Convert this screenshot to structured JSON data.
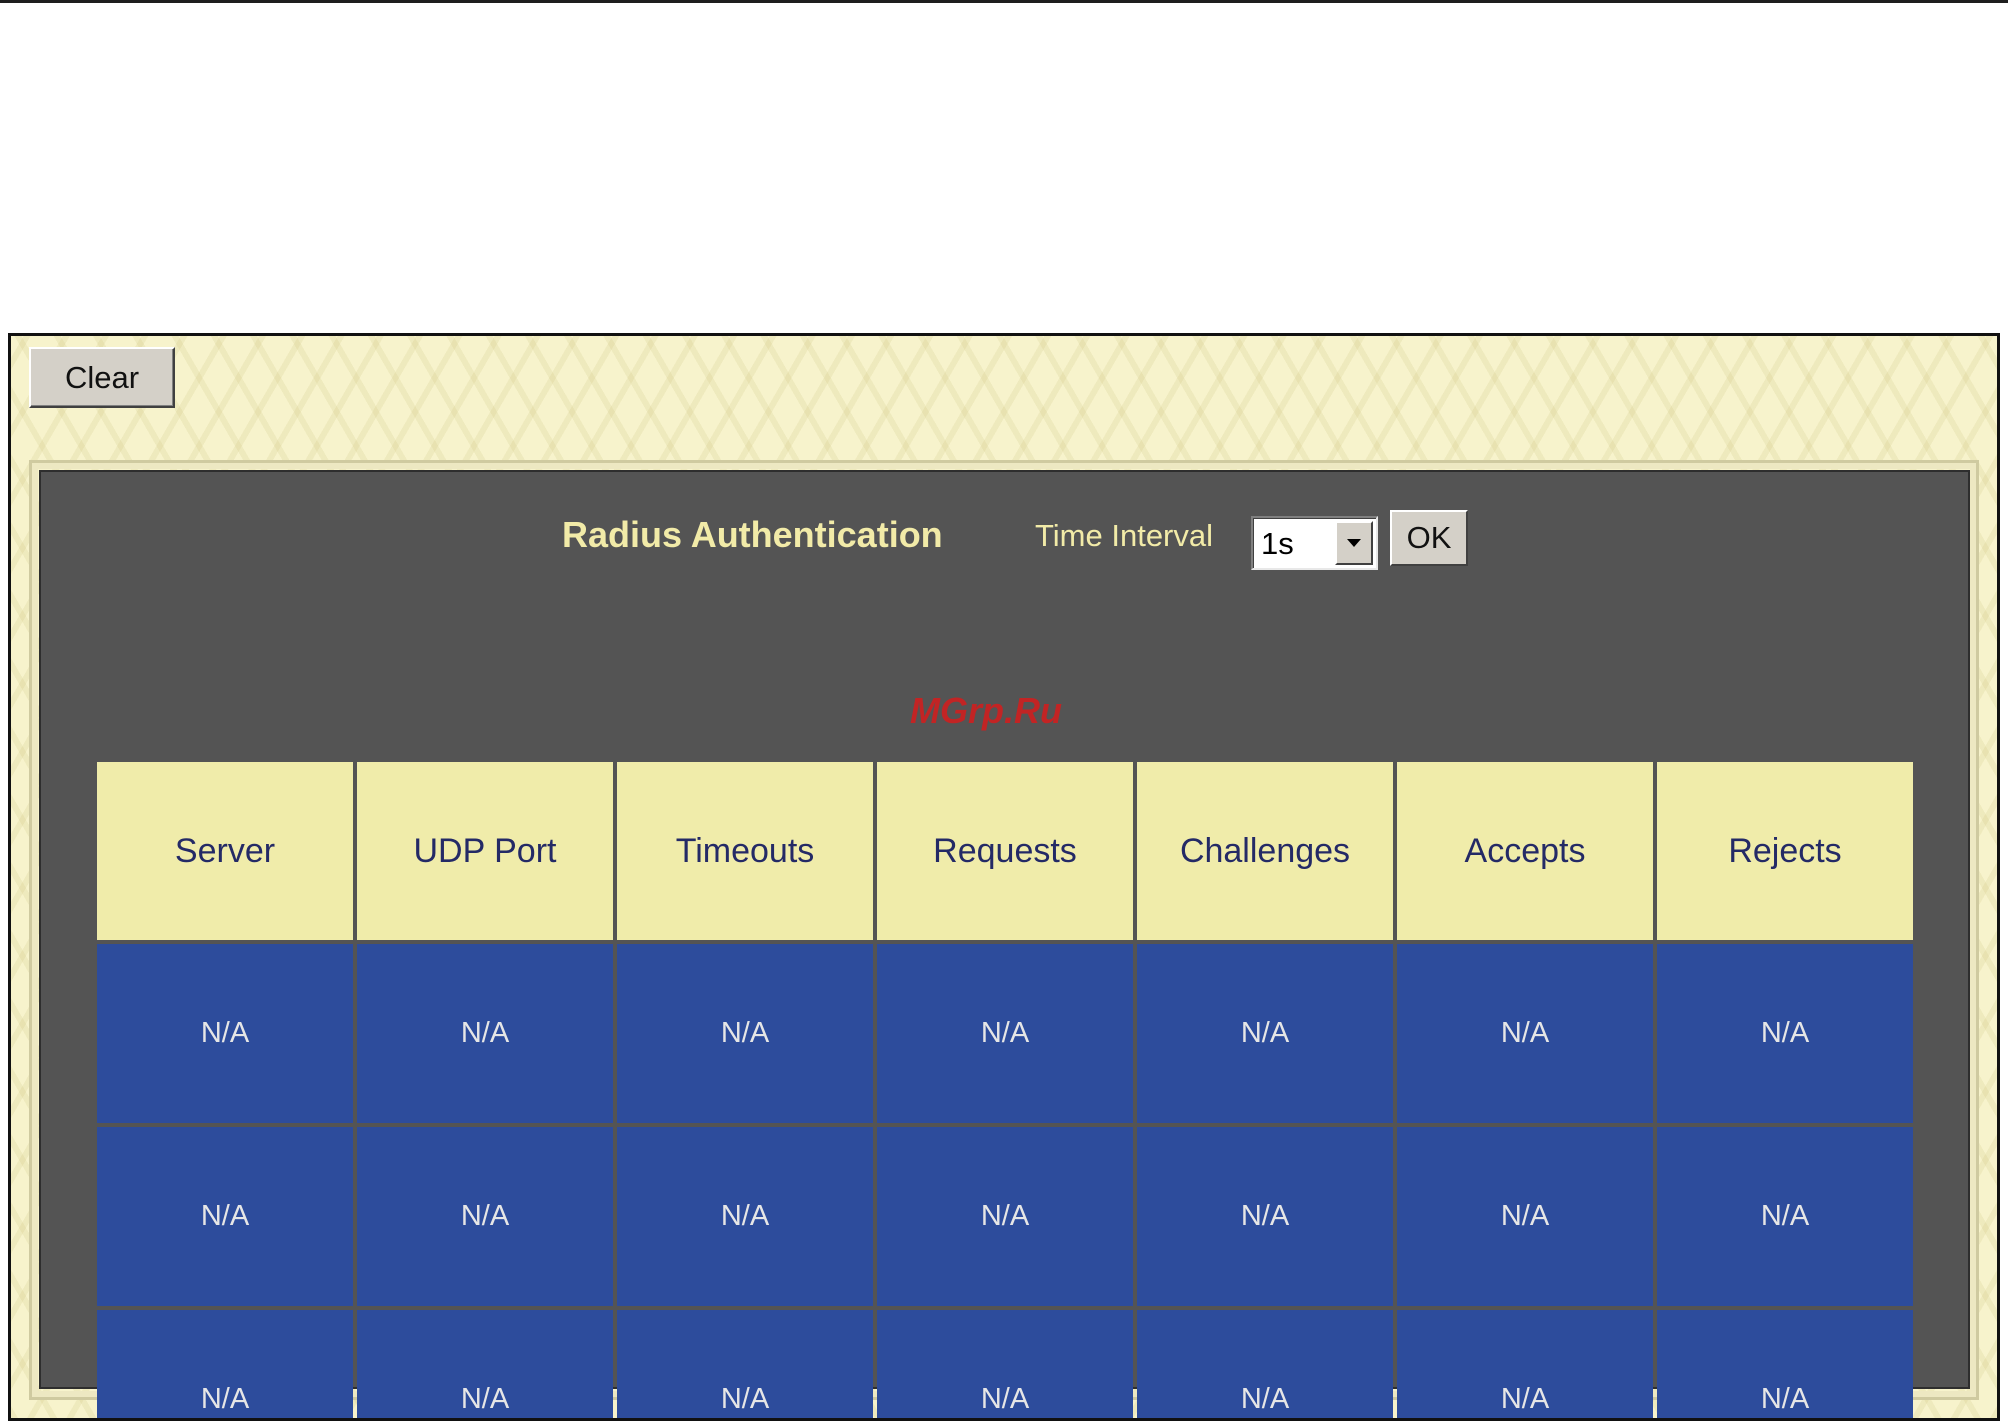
{
  "toolbar": {
    "clear_label": "Clear"
  },
  "panel": {
    "title": "Radius Authentication",
    "time_interval_label": "Time Interval",
    "time_interval_value": "1s",
    "ok_label": "OK"
  },
  "table": {
    "headers": [
      "Server",
      "UDP Port",
      "Timeouts",
      "Requests",
      "Challenges",
      "Accepts",
      "Rejects"
    ],
    "rows": [
      [
        "N/A",
        "N/A",
        "N/A",
        "N/A",
        "N/A",
        "N/A",
        "N/A"
      ],
      [
        "N/A",
        "N/A",
        "N/A",
        "N/A",
        "N/A",
        "N/A",
        "N/A"
      ],
      [
        "N/A",
        "N/A",
        "N/A",
        "N/A",
        "N/A",
        "N/A",
        "N/A"
      ]
    ]
  },
  "watermark": "MGrp.Ru",
  "colors": {
    "panel_bg": "#545454",
    "header_cell": "#f0ecaa",
    "data_cell": "#2d4c9c",
    "title_text": "#f2eba8",
    "page_pattern": "#f7f3cc"
  },
  "icons": {
    "dropdown": "chevron-down-icon"
  }
}
